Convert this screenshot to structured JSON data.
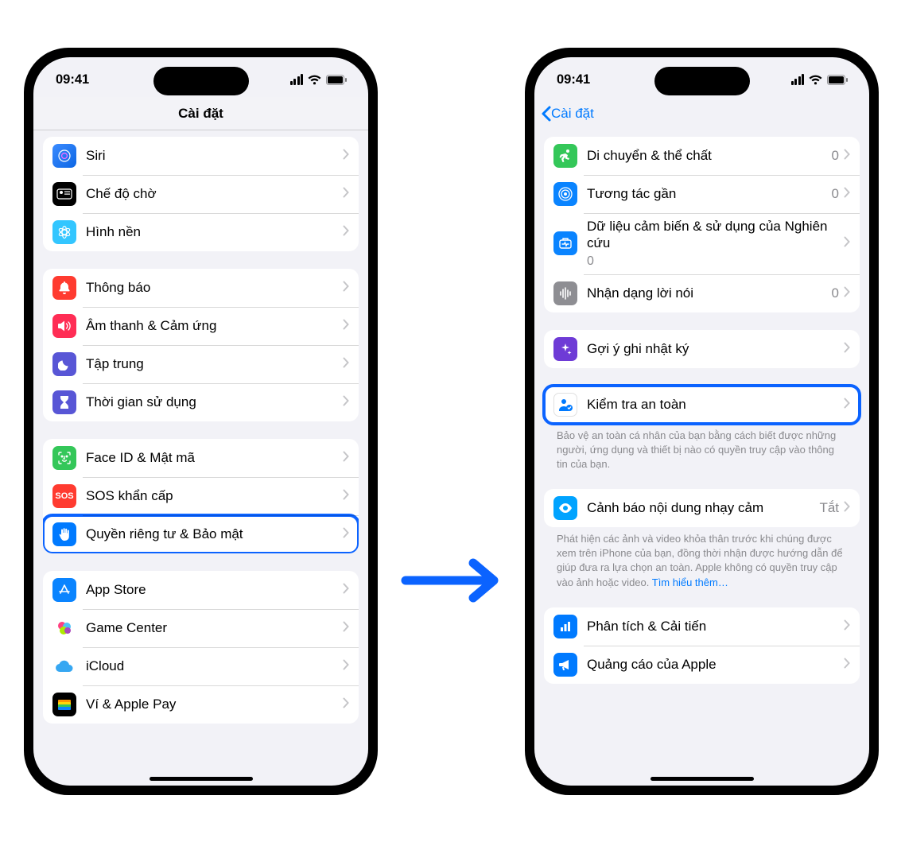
{
  "status": {
    "time": "09:41"
  },
  "left": {
    "title": "Cài đặt",
    "groups": [
      {
        "rows": [
          {
            "icon": "siri",
            "label": "Siri"
          },
          {
            "icon": "standby",
            "label": "Chế độ chờ"
          },
          {
            "icon": "wallpaper",
            "label": "Hình nền"
          }
        ]
      },
      {
        "rows": [
          {
            "icon": "notif",
            "label": "Thông báo"
          },
          {
            "icon": "sound",
            "label": "Âm thanh & Cảm ứng"
          },
          {
            "icon": "focus",
            "label": "Tập trung"
          },
          {
            "icon": "screentime",
            "label": "Thời gian sử dụng"
          }
        ]
      },
      {
        "rows": [
          {
            "icon": "faceid",
            "label": "Face ID & Mật mã"
          },
          {
            "icon": "sos",
            "label": "SOS khẩn cấp"
          },
          {
            "icon": "privacy",
            "label": "Quyền riêng tư & Bảo mật",
            "highlight": true
          }
        ]
      },
      {
        "rows": [
          {
            "icon": "appstore",
            "label": "App Store"
          },
          {
            "icon": "gamecenter",
            "label": "Game Center"
          },
          {
            "icon": "icloud",
            "label": "iCloud"
          },
          {
            "icon": "wallet",
            "label": "Ví & Apple Pay"
          }
        ]
      }
    ]
  },
  "right": {
    "back": "Cài đặt",
    "groups": [
      {
        "rows": [
          {
            "icon": "motion",
            "label": "Di chuyển & thể chất",
            "detail": "0"
          },
          {
            "icon": "nearby",
            "label": "Tương tác gần",
            "detail": "0"
          },
          {
            "icon": "research",
            "label": "Dữ liệu cảm biến & sử dụng của Nghiên cứu",
            "sub": "0"
          },
          {
            "icon": "speech",
            "label": "Nhận dạng lời nói",
            "detail": "0"
          }
        ]
      },
      {
        "rows": [
          {
            "icon": "journal",
            "label": "Gợi ý ghi nhật ký"
          }
        ]
      },
      {
        "highlight": true,
        "rows": [
          {
            "icon": "safety",
            "label": "Kiểm tra an toàn"
          }
        ],
        "footer": "Bảo vệ an toàn cá nhân của bạn bằng cách biết được những người, ứng dụng và thiết bị nào có quyền truy cập vào thông tin của bạn."
      },
      {
        "rows": [
          {
            "icon": "sensitive",
            "label": "Cảnh báo nội dung nhạy cảm",
            "detail": "Tắt"
          }
        ],
        "footer": "Phát hiện các ảnh và video khỏa thân trước khi chúng được xem trên iPhone của bạn, đồng thời nhận được hướng dẫn để giúp đưa ra lựa chọn an toàn. Apple không có quyền truy cập vào ảnh hoặc video. ",
        "footer_link": "Tìm hiểu thêm…"
      },
      {
        "rows": [
          {
            "icon": "analytics",
            "label": "Phân tích & Cải tiến"
          },
          {
            "icon": "ads",
            "label": "Quảng cáo của Apple"
          }
        ]
      }
    ]
  }
}
